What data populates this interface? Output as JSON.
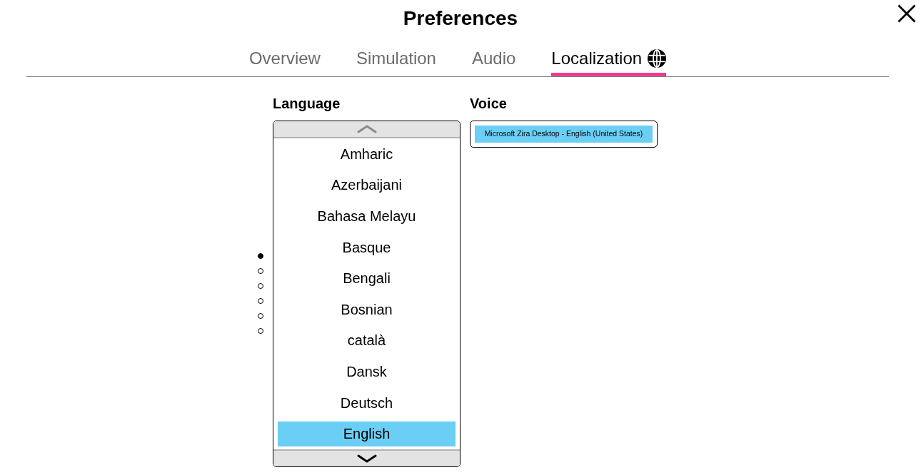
{
  "window": {
    "title": "Preferences"
  },
  "tabs": [
    {
      "label": "Overview",
      "selected": false,
      "kind": "text"
    },
    {
      "label": "Simulation",
      "selected": false,
      "kind": "text"
    },
    {
      "label": "Audio",
      "selected": false,
      "kind": "text"
    },
    {
      "label": "Localization",
      "selected": true,
      "kind": "icon"
    }
  ],
  "language": {
    "heading": "Language",
    "pages": [
      {
        "selected": true
      },
      {
        "selected": false
      },
      {
        "selected": false
      },
      {
        "selected": false
      },
      {
        "selected": false
      },
      {
        "selected": false
      }
    ],
    "scroll_up": {
      "disabled": true
    },
    "items": [
      {
        "label": "Amharic",
        "selected": false
      },
      {
        "label": "Azerbaijani",
        "selected": false
      },
      {
        "label": "Bahasa Melayu",
        "selected": false
      },
      {
        "label": "Basque",
        "selected": false
      },
      {
        "label": "Bengali",
        "selected": false
      },
      {
        "label": "Bosnian",
        "selected": false
      },
      {
        "label": "català",
        "selected": false
      },
      {
        "label": "Dansk",
        "selected": false
      },
      {
        "label": "Deutsch",
        "selected": false
      },
      {
        "label": "English",
        "selected": true
      }
    ],
    "scroll_down": {
      "disabled": false
    }
  },
  "voice": {
    "heading": "Voice",
    "items": [
      {
        "label": "Microsoft Zira Desktop - English (United States)",
        "selected": true
      }
    ]
  }
}
